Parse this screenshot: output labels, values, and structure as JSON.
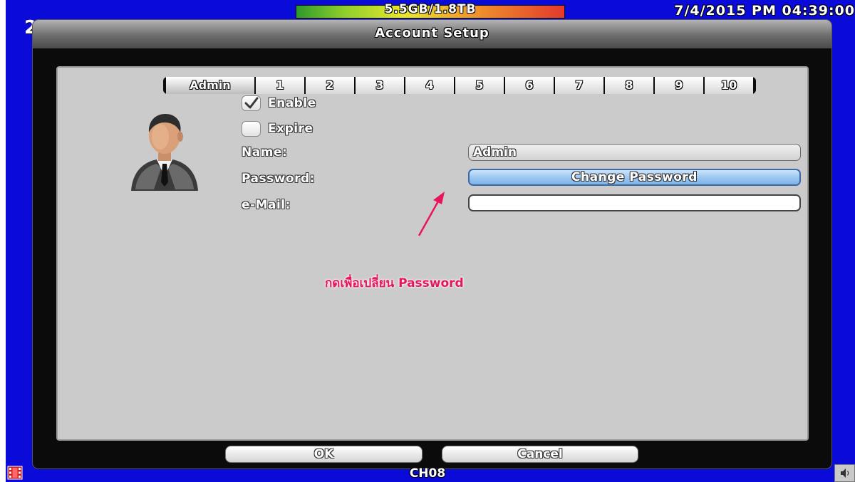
{
  "status_bar": {
    "storage": "5.5GB/1.8TB",
    "datetime": "7/4/2015 PM 04:39:00",
    "left_peek": "2"
  },
  "dialog": {
    "title": "Account Setup",
    "tabs": [
      "Admin",
      "1",
      "2",
      "3",
      "4",
      "5",
      "6",
      "7",
      "8",
      "9",
      "10"
    ],
    "active_tab": "Admin",
    "enable_label": "Enable",
    "enable_checked": true,
    "expire_label": "Expire",
    "expire_checked": false,
    "name_label": "Name:",
    "name_value": "Admin",
    "password_label": "Password:",
    "change_password_label": "Change Password",
    "email_label": "e-Mail:",
    "email_value": "",
    "annotation": "กดเพื่อเปลี่ยน Password",
    "ok_label": "OK",
    "cancel_label": "Cancel"
  },
  "bottom_bar": {
    "channel": "CH08"
  },
  "icons": {
    "avatar": "user-avatar-icon",
    "checkmark": "checkmark-icon",
    "film": "film-strip-icon",
    "speaker": "speaker-icon"
  },
  "colors": {
    "background": "#0a0ad9",
    "panel": "#cbcbcb",
    "accent_button": "#9cc8f2",
    "annotation": "#e8145e"
  }
}
